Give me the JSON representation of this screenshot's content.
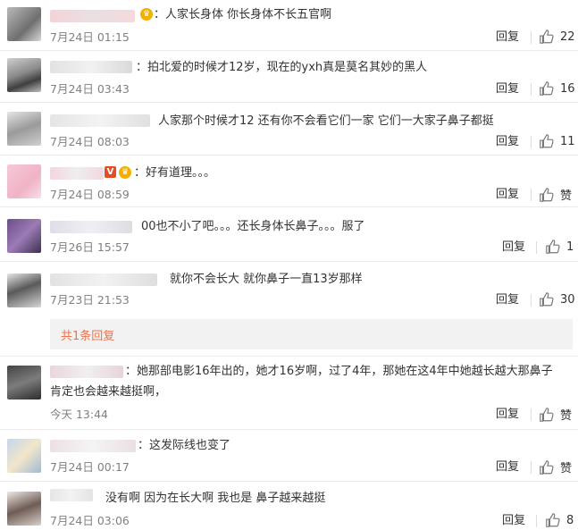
{
  "comments": [
    {
      "text": "：人家长身体    你长身体不长五官啊",
      "time": "7月24日 01:15",
      "reply": "回复",
      "likes": "22"
    },
    {
      "text": "：拍北爱的时候才12岁，现在的yxh真是莫名其妙的黑人",
      "time": "7月24日 03:43",
      "reply": "回复",
      "likes": "16"
    },
    {
      "text": "人家那个时候才12 还有你不会看它们一家 它们一大家子鼻子都挺",
      "time": "7月24日 08:03",
      "reply": "回复",
      "likes": "11"
    },
    {
      "text": "：好有道理。。。",
      "time": "7月24日 08:59",
      "reply": "回复",
      "likes": "赞"
    },
    {
      "text": "00也不小了吧。。。还长身体长鼻子。。。服了",
      "time": "7月26日 15:57",
      "reply": "回复",
      "likes": "1"
    },
    {
      "text": "就你不会长大  就你鼻子一直13岁那样",
      "time": "7月23日 21:53",
      "reply": "回复",
      "likes": "30"
    },
    {
      "text": "：她那部电影16年出的，她才16岁啊，过了4年，那她在这4年中她越长越大那鼻子",
      "text2": "肯定也会越来越挺啊，",
      "time": "今天 13:44",
      "reply": "回复",
      "likes": "赞"
    },
    {
      "text": "：这发际线也变了",
      "time": "7月24日 00:17",
      "reply": "回复",
      "likes": "赞"
    },
    {
      "text": "没有啊 因为在长大啊 我也是 鼻子越来越挺",
      "time": "7月24日 03:06",
      "reply": "回复",
      "likes": "8"
    }
  ],
  "more_replies": "共1条回复",
  "badge_v": "V",
  "colors": {
    "accent": "#eb7350",
    "muted": "#808080"
  }
}
